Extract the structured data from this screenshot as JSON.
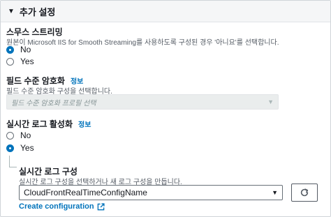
{
  "section": {
    "title": "추가 설정",
    "caret_icon": "caret-down-icon"
  },
  "smooth_streaming": {
    "label": "스무스 스트리밍",
    "description": "원본이 Microsoft IIS for Smooth Streaming를 사용하도록 구성된 경우 '아니요'를 선택합니다.",
    "options": [
      {
        "label": "No",
        "selected": true
      },
      {
        "label": "Yes",
        "selected": false
      }
    ]
  },
  "field_level_encryption": {
    "label": "필드 수준 암호화",
    "info": "정보",
    "description": "필드 수준 암호화 구성을 선택합니다.",
    "placeholder": "필드 수준 암호화 프로필 선택",
    "disabled": true
  },
  "realtime_logs": {
    "label": "실시간 로그 활성화",
    "info": "정보",
    "options": [
      {
        "label": "No",
        "selected": false
      },
      {
        "label": "Yes",
        "selected": true
      }
    ],
    "config": {
      "label": "실시간 로그 구성",
      "description": "실시간 로그 구성을 선택하거나 새 로그 구성을 만듭니다.",
      "selected": "CloudFrontRealTimeConfigName",
      "refresh_icon": "refresh-icon",
      "create_link": "Create configuration",
      "external_icon": "external-link-icon"
    }
  },
  "colors": {
    "accent": "#0073bb",
    "text": "#16191f",
    "muted": "#545b64",
    "header_bg": "#f5f6f7"
  }
}
